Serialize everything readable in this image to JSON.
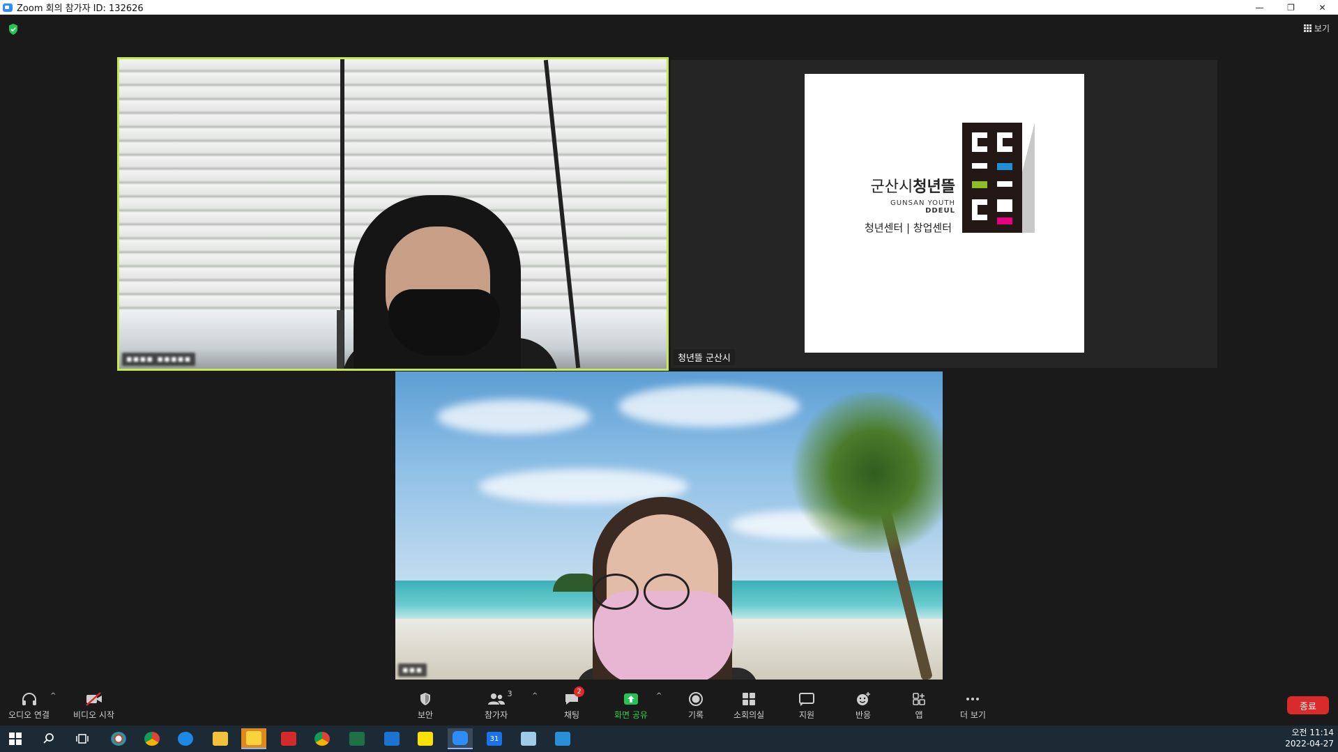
{
  "window": {
    "title": "Zoom 회의 참가자 ID: 132626",
    "minimize": "—",
    "restore": "❐",
    "close": "✕"
  },
  "top": {
    "view_label": "보기"
  },
  "tiles": [
    {
      "name_tag": "▪▪▪▪ ▪▪▪▪▪",
      "highlighted": true
    },
    {
      "name_tag": "청년뜰 군산시"
    },
    {
      "name_tag": "▪▪▪"
    }
  ],
  "logo": {
    "kr_prefix": "군산시",
    "kr_bold": "청년뜰",
    "en_line1": "GUNSAN YOUTH",
    "en_line2": "DDEUL",
    "sub": "청년센터 | 창업센터",
    "colors": {
      "dark": "#231815",
      "blue": "#1f8fd6",
      "green": "#8cbf26",
      "pink": "#e5007f"
    }
  },
  "toolbar": {
    "audio": "오디오 연결",
    "video": "비디오 시작",
    "security": "보안",
    "participants": "참가자",
    "participants_count": "3",
    "chat": "채팅",
    "chat_badge": "2",
    "share": "화면 공유",
    "record": "기록",
    "breakout": "소회의실",
    "support": "지원",
    "reactions": "반응",
    "apps": "앱",
    "more": "더 보기",
    "end": "종료"
  },
  "taskbar": {
    "time": "오전 11:14",
    "date": "2022-04-27",
    "calendar_day": "31"
  }
}
